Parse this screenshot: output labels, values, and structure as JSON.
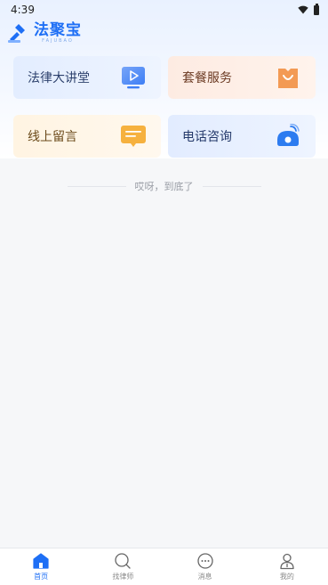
{
  "status_bar": {
    "time": "4:39"
  },
  "header": {
    "logo_text": "法聚宝",
    "logo_sub": "FAJUBAO"
  },
  "cards": [
    {
      "label": "法律大讲堂",
      "icon": "tv-play-icon",
      "color": "#3d7ef5"
    },
    {
      "label": "套餐服务",
      "icon": "shopping-bag-icon",
      "color": "#f39a54"
    },
    {
      "label": "线上留言",
      "icon": "message-bubble-icon",
      "color": "#f6b13e"
    },
    {
      "label": "电话咨询",
      "icon": "telephone-icon",
      "color": "#2d7cf0"
    }
  ],
  "end_text": "哎呀，到底了",
  "tabbar": {
    "items": [
      {
        "label": "首页",
        "icon": "home-icon",
        "active": true
      },
      {
        "label": "找律师",
        "icon": "search-icon",
        "active": false
      },
      {
        "label": "消息",
        "icon": "chat-icon",
        "active": false
      },
      {
        "label": "我的",
        "icon": "user-icon",
        "active": false
      }
    ],
    "active_color": "#1e6ff5",
    "inactive_color": "#888888"
  }
}
